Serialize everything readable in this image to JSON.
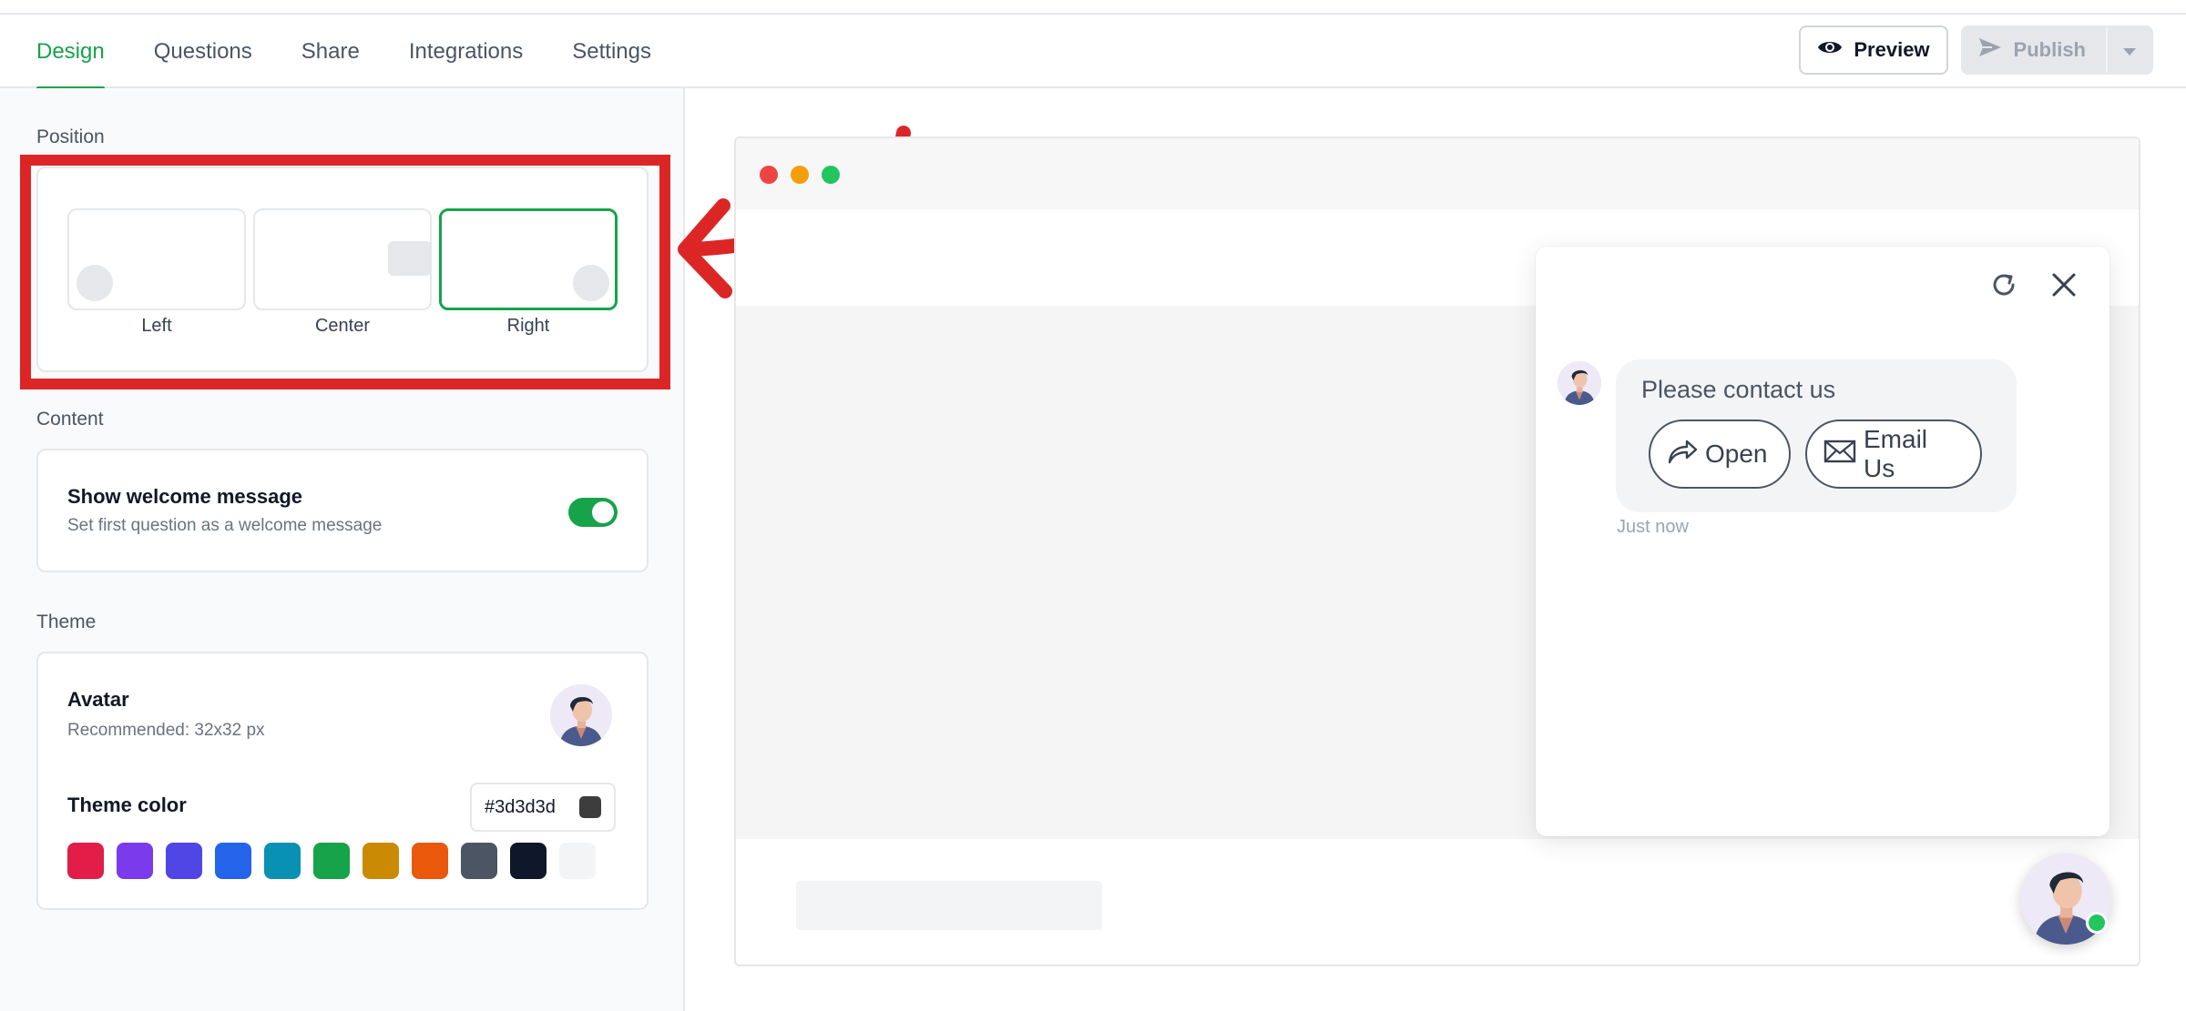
{
  "tabs": [
    {
      "label": "Design",
      "active": true
    },
    {
      "label": "Questions",
      "active": false
    },
    {
      "label": "Share",
      "active": false
    },
    {
      "label": "Integrations",
      "active": false
    },
    {
      "label": "Settings",
      "active": false
    }
  ],
  "header": {
    "preview_label": "Preview",
    "publish_label": "Publish"
  },
  "position": {
    "section_label": "Position",
    "options": [
      {
        "label": "Left",
        "selected": false
      },
      {
        "label": "Center",
        "selected": false
      },
      {
        "label": "Right",
        "selected": true
      }
    ]
  },
  "content": {
    "section_label": "Content",
    "welcome_title": "Show welcome message",
    "welcome_sub": "Set first question as a welcome message",
    "welcome_enabled": true
  },
  "theme": {
    "section_label": "Theme",
    "avatar_title": "Avatar",
    "avatar_sub": "Recommended: 32x32 px",
    "color_title": "Theme color",
    "color_value": "#3d3d3d",
    "swatches": [
      "#e11d48",
      "#7c3aed",
      "#4f46e5",
      "#2563eb",
      "#0891b2",
      "#16a34a",
      "#ca8a04",
      "#ea580c",
      "#4b5563",
      "#0f172a",
      "#f3f4f6"
    ]
  },
  "preview": {
    "traffic_lights": [
      "#ef4444",
      "#f59e0b",
      "#22c55e"
    ],
    "message": "Please contact us",
    "buttons": [
      {
        "label": "Open",
        "icon": "share-arrow-icon"
      },
      {
        "label": "Email Us",
        "icon": "mail-icon"
      }
    ],
    "timestamp": "Just now"
  },
  "colors": {
    "accent": "#16a34a",
    "annotation": "#dc2626"
  }
}
